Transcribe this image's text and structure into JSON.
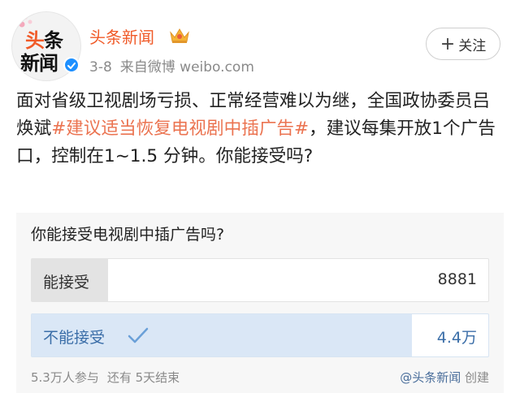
{
  "header": {
    "avatar_line1_a": "头",
    "avatar_line1_b": "条",
    "avatar_line2": "新闻",
    "account_name": "头条新闻",
    "post_date": "3-8",
    "post_source": "来自微博 weibo.com",
    "follow_label": "关注",
    "follow_plus": "+"
  },
  "post": {
    "text_before": "面对省级卫视剧场亏损、正常经营难以为继，全国政协委员吕焕斌",
    "hashtag": "#建议适当恢复电视剧中插广告#",
    "text_after": "，建议每集开放1个广告口，控制在1~1.5 分钟。你能接受吗?"
  },
  "poll": {
    "question": "你能接受电视剧中插广告吗?",
    "options": [
      {
        "label": "能接受",
        "count": "8881",
        "share": 0.168
      },
      {
        "label": "不能接受",
        "count": "4.4万",
        "share": 0.832,
        "selected": true
      }
    ],
    "participants": "5.3万人参与",
    "remaining": "还有 5天结束",
    "creator": "@头条新闻",
    "created_label": "创建"
  },
  "colors": {
    "brand_orange": "#f05a28",
    "hashtag": "#eb7350",
    "selected_fill": "#dae7f6",
    "selected_text": "#3b6ea8",
    "verified_blue": "#1e90ff"
  },
  "icons": [
    "blossom-icon",
    "verified-badge-icon",
    "crown-icon",
    "plus-icon",
    "check-icon"
  ]
}
